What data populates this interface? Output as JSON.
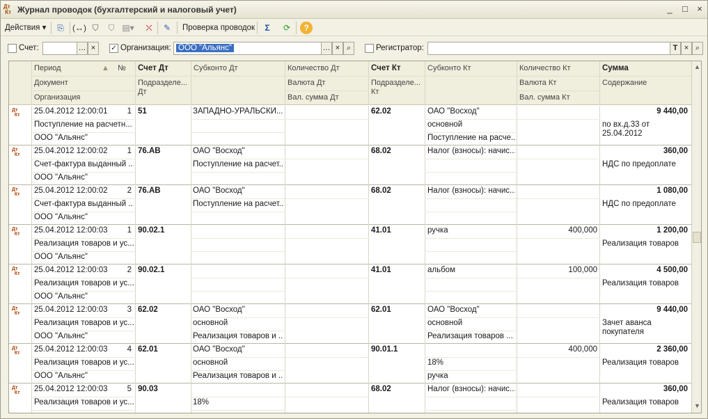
{
  "window": {
    "title": "Журнал проводок (бухгалтерский и налоговый учет)",
    "icon_text": "Дт Кт",
    "controls": [
      "_",
      "□",
      "×"
    ]
  },
  "toolbar": {
    "actions_label": "Действия",
    "check_entries_label": "Проверка проводок",
    "icons": [
      "add-copy-icon",
      "move-icon",
      "filter-icon",
      "filter-history-icon",
      "filter-clear-icon",
      "edit-icon",
      "sum-icon",
      "refresh-icon",
      "help-icon"
    ]
  },
  "filters": {
    "account_label": "Счет:",
    "account_value": "",
    "account_checked": false,
    "organization_label": "Организация:",
    "organization_value": "ООО \"Альянс\"",
    "organization_checked": true,
    "registrar_label": "Регистратор:",
    "registrar_value": "",
    "registrar_checked": false
  },
  "columns": {
    "period": "Период",
    "number": "№",
    "document": "Документ",
    "organization": "Организация",
    "account_dt": "Счет Дт",
    "division_dt": "Подразделе... Дт",
    "subconto_dt": "Субконто Дт",
    "quantity_dt": "Количество Дт",
    "currency_dt": "Валюта Дт",
    "cur_sum_dt": "Вал. сумма Дт",
    "account_kt": "Счет Кт",
    "division_kt": "Подразделе... Кт",
    "subconto_kt": "Субконто Кт",
    "quantity_kt": "Количество Кт",
    "currency_kt": "Валюта Кт",
    "cur_sum_kt": "Вал. сумма Кт",
    "sum": "Сумма",
    "content": "Содержание"
  },
  "rows": [
    {
      "period": "25.04.2012 12:00:01",
      "num": "1",
      "doc": "Поступление на расчетн...",
      "org": "ООО \"Альянс\"",
      "acc_dt": "51",
      "sub_dt": [
        "ЗАПАДНО-УРАЛЬСКИ...",
        "",
        ""
      ],
      "qty_dt": "",
      "acc_kt": "62.02",
      "sub_kt": [
        "ОАО \"Восход\"",
        "основной",
        "Поступление на расче..."
      ],
      "qty_kt": "",
      "sum": "9 440,00",
      "content": "по вх.д.33 от 25.04.2012"
    },
    {
      "period": "25.04.2012 12:00:02",
      "num": "1",
      "doc": "Счет-фактура выданный ...",
      "org": "ООО \"Альянс\"",
      "acc_dt": "76.АВ",
      "sub_dt": [
        "ОАО \"Восход\"",
        "Поступление на расчет...",
        ""
      ],
      "qty_dt": "",
      "acc_kt": "68.02",
      "sub_kt": [
        "Налог (взносы): начис...",
        "",
        ""
      ],
      "qty_kt": "",
      "sum": "360,00",
      "content": "НДС по предоплате"
    },
    {
      "period": "25.04.2012 12:00:02",
      "num": "2",
      "doc": "Счет-фактура выданный ...",
      "org": "ООО \"Альянс\"",
      "acc_dt": "76.АВ",
      "sub_dt": [
        "ОАО \"Восход\"",
        "Поступление на расчет...",
        ""
      ],
      "qty_dt": "",
      "acc_kt": "68.02",
      "sub_kt": [
        "Налог (взносы): начис...",
        "",
        ""
      ],
      "qty_kt": "",
      "sum": "1 080,00",
      "content": "НДС по предоплате"
    },
    {
      "period": "25.04.2012 12:00:03",
      "num": "1",
      "doc": "Реализация товаров и ус...",
      "org": "ООО \"Альянс\"",
      "acc_dt": "90.02.1",
      "sub_dt": [
        "",
        "",
        ""
      ],
      "qty_dt": "",
      "acc_kt": "41.01",
      "sub_kt": [
        "ручка",
        "",
        ""
      ],
      "qty_kt": "400,000",
      "sum": "1 200,00",
      "content": "Реализация товаров"
    },
    {
      "period": "25.04.2012 12:00:03",
      "num": "2",
      "doc": "Реализация товаров и ус...",
      "org": "ООО \"Альянс\"",
      "acc_dt": "90.02.1",
      "sub_dt": [
        "",
        "",
        ""
      ],
      "qty_dt": "",
      "acc_kt": "41.01",
      "sub_kt": [
        "альбом",
        "",
        ""
      ],
      "qty_kt": "100,000",
      "sum": "4 500,00",
      "content": "Реализация товаров"
    },
    {
      "period": "25.04.2012 12:00:03",
      "num": "3",
      "doc": "Реализация товаров и ус...",
      "org": "ООО \"Альянс\"",
      "acc_dt": "62.02",
      "sub_dt": [
        "ОАО \"Восход\"",
        "основной",
        "Реализация товаров и ..."
      ],
      "qty_dt": "",
      "acc_kt": "62.01",
      "sub_kt": [
        "ОАО \"Восход\"",
        "основной",
        "Реализация товаров ..."
      ],
      "qty_kt": "",
      "sum": "9 440,00",
      "content": "Зачет аванса покупателя"
    },
    {
      "period": "25.04.2012 12:00:03",
      "num": "4",
      "doc": "Реализация товаров и ус...",
      "org": "ООО \"Альянс\"",
      "acc_dt": "62.01",
      "sub_dt": [
        "ОАО \"Восход\"",
        "основной",
        "Реализация товаров и ..."
      ],
      "qty_dt": "",
      "acc_kt": "90.01.1",
      "sub_kt": [
        "",
        "18%",
        "ручка"
      ],
      "qty_kt": "400,000",
      "sum": "2 360,00",
      "content": "Реализация товаров"
    },
    {
      "period": "25.04.2012 12:00:03",
      "num": "5",
      "doc": "Реализация товаров и ус...",
      "org": "",
      "acc_dt": "90.03",
      "sub_dt": [
        "",
        "18%",
        ""
      ],
      "qty_dt": "",
      "acc_kt": "68.02",
      "sub_kt": [
        "Налог (взносы): начис...",
        "",
        ""
      ],
      "qty_kt": "",
      "sum": "360,00",
      "content": "Реализация товаров"
    }
  ]
}
